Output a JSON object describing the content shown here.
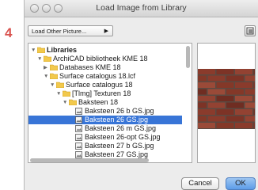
{
  "step_number": "4",
  "window": {
    "title": "Load Image from Library"
  },
  "picture_select": {
    "value": "Load Other Picture..."
  },
  "tree": {
    "items": [
      {
        "label": "Libraries",
        "depth": 0,
        "expanded": true,
        "bold": true,
        "icon": "folder-icon"
      },
      {
        "label": "ArchiCAD bibliotheek KME 18",
        "depth": 1,
        "expanded": true,
        "icon": "folder-icon"
      },
      {
        "label": "Databases KME 18",
        "depth": 2,
        "expanded": false,
        "icon": "folder-icon"
      },
      {
        "label": "Surface catalogus 18.lcf",
        "depth": 2,
        "expanded": true,
        "icon": "folder-icon"
      },
      {
        "label": "Surface catalogus 18",
        "depth": 3,
        "expanded": true,
        "icon": "folder-icon"
      },
      {
        "label": "[Tlmg] Texturen 18",
        "depth": 4,
        "expanded": true,
        "icon": "folder-icon"
      },
      {
        "label": "Baksteen 18",
        "depth": 5,
        "expanded": true,
        "icon": "folder-icon"
      },
      {
        "label": "Baksteen 26 b GS.jpg",
        "depth": 6,
        "icon": "image-file-icon"
      },
      {
        "label": "Baksteen 26 GS.jpg",
        "depth": 6,
        "icon": "image-file-icon",
        "selected": true
      },
      {
        "label": "Baksteen 26 m GS.jpg",
        "depth": 6,
        "icon": "image-file-icon"
      },
      {
        "label": "Baksteen 26-opt GS.jpg",
        "depth": 6,
        "icon": "image-file-icon"
      },
      {
        "label": "Baksteen 27 b GS.jpg",
        "depth": 6,
        "icon": "image-file-icon"
      },
      {
        "label": "Baksteen 27 GS.jpg",
        "depth": 6,
        "icon": "image-file-icon"
      }
    ]
  },
  "buttons": {
    "cancel": "Cancel",
    "ok": "OK"
  },
  "colors": {
    "selection": "#3875d7",
    "brick": "#8a3b2c",
    "mortar": "#5a4a42",
    "step_number": "#d9534f"
  }
}
